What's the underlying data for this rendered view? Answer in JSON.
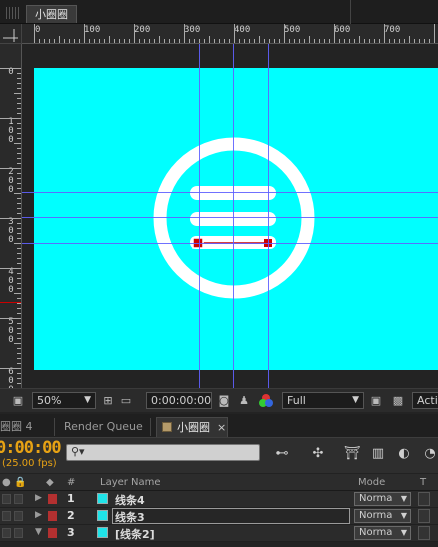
{
  "comp_tab": {
    "label": "小圈圈"
  },
  "ruler_h": {
    "labels": [
      "0",
      "100",
      "200",
      "300",
      "400",
      "500",
      "600",
      "700"
    ]
  },
  "ruler_v": {
    "labels": [
      "0",
      "100",
      "200",
      "300",
      "400",
      "500",
      "600"
    ]
  },
  "viewer": {
    "zoom": "50%",
    "timecode": "0:00:00:00",
    "resolution": "Full",
    "view_label": "Acti",
    "canvas_color": "#00ffff",
    "guide_color": "#6060ff",
    "handle_color": "#cc0000"
  },
  "panel_tabs": [
    {
      "label": "圈圈 4",
      "active": false
    },
    {
      "label": "Render Queue",
      "active": false
    },
    {
      "label": "小圈圈",
      "active": true
    }
  ],
  "timeline": {
    "timecode": "0:00:00",
    "fps": "(25.00 fps)",
    "search_placeholder": "",
    "accent": "#e7a214"
  },
  "layer_header": {
    "num": "#",
    "name": "Layer Name",
    "mode": "Mode",
    "trkmat": "T"
  },
  "layers": [
    {
      "num": "1",
      "name": "线条4",
      "mode": "Norma",
      "twirl": "▶",
      "selected": false
    },
    {
      "num": "2",
      "name": "线条3",
      "mode": "Norma",
      "twirl": "▶",
      "selected": true
    },
    {
      "num": "3",
      "name": "[线条2]",
      "mode": "Norma",
      "twirl": "▼",
      "selected": false
    }
  ]
}
